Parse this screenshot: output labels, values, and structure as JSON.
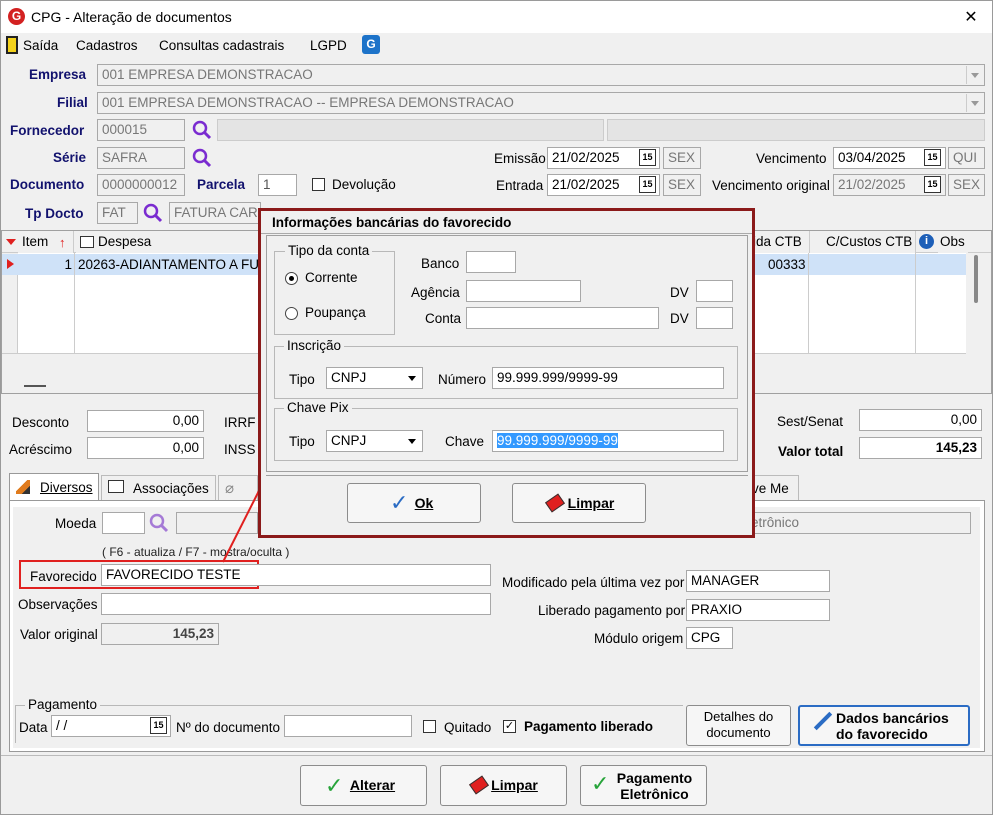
{
  "window": {
    "title": "CPG - Alteração de documentos",
    "close_glyph": "✕"
  },
  "menu": [
    "Saída",
    "Cadastros",
    "Consultas cadastrais",
    "LGPD"
  ],
  "header": {
    "empresa_label": "Empresa",
    "empresa_value": "001 EMPRESA DEMONSTRACAO",
    "filial_label": "Filial",
    "filial_value": "001 EMPRESA DEMONSTRACAO -- EMPRESA DEMONSTRACAO",
    "fornecedor_label": "Fornecedor",
    "fornecedor_value": "000015",
    "serie_label": "Série",
    "serie_value": "SAFRA",
    "documento_label": "Documento",
    "documento_value": "0000000012",
    "parcela_label": "Parcela",
    "parcela_value": "1",
    "devolucao_label": "Devolução",
    "tpdocto_label": "Tp Docto",
    "tpdocto_value": "FAT",
    "tpdocto_desc": "FATURA CAR",
    "emissao_label": "Emissão",
    "emissao_value": "21/02/2025",
    "emissao_day": "SEX",
    "entrada_label": "Entrada",
    "entrada_value": "21/02/2025",
    "entrada_day": "SEX",
    "vencimento_label": "Vencimento",
    "vencimento_value": "03/04/2025",
    "vencimento_day": "QUI",
    "venc_original_label": "Vencimento original",
    "venc_original_value": "21/02/2025",
    "venc_original_day": "SEX",
    "cal_glyph": "15"
  },
  "grid": {
    "col_item": "Item",
    "col_despesa": "Despesa",
    "col_contactb": "ida CTB",
    "col_ccustos": "C/Custos CTB",
    "col_obs": "Obs",
    "row_item": "1",
    "row_despesa": "20263-ADIANTAMENTO A FU",
    "row_contactb": "00333"
  },
  "totals": {
    "desconto_label": "Desconto",
    "desconto_value": "0,00",
    "acrescimo_label": "Acréscimo",
    "acrescimo_value": "0,00",
    "irrf_label": "IRRF",
    "inss_label": "INSS",
    "sest_label": "Sest/Senat",
    "sest_value": "0,00",
    "total_label": "Valor total",
    "total_value": "145,23"
  },
  "tabs": {
    "diversos": "Diversos",
    "associacoes": "Associações",
    "last": "ve Me"
  },
  "diversos": {
    "moeda_label": "Moeda",
    "hint": "( F6 - atualiza / F7 - mostra/oculta )",
    "eletronico_fragment": "etrônico",
    "favorecido_label": "Favorecido",
    "favorecido_value": "FAVORECIDO TESTE",
    "observacoes_label": "Observações",
    "valor_original_label": "Valor original",
    "valor_original_value": "145,23",
    "modificado_label": "Modificado pela última vez por",
    "modificado_value": "MANAGER",
    "liberado_label": "Liberado pagamento por",
    "liberado_value": "PRAXIO",
    "modulo_label": "Módulo origem",
    "modulo_value": "CPG"
  },
  "pagamento": {
    "group": "Pagamento",
    "data_label": "Data",
    "data_value": " /  /",
    "ndoc_label": "Nº do documento",
    "quitado_label": "Quitado",
    "liberado_label": "Pagamento liberado",
    "detalhes_line1": "Detalhes do",
    "detalhes_line2": "documento",
    "dados_line1": "Dados bancários",
    "dados_line2": "do favorecido"
  },
  "footer": {
    "alterar": "Alterar",
    "limpar": "Limpar",
    "pag_line1": "Pagamento",
    "pag_line2": "Eletrônico"
  },
  "dialog": {
    "title": "Informações bancárias do favorecido",
    "tipo_conta": "Tipo da conta",
    "corrente": "Corrente",
    "poupanca": "Poupança",
    "banco": "Banco",
    "agencia": "Agência",
    "conta": "Conta",
    "dv": "DV",
    "inscricao": "Inscrição",
    "tipo": "Tipo",
    "tipo_value": "CNPJ",
    "numero": "Número",
    "numero_value": "99.999.999/9999-99",
    "chave_pix": "Chave Pix",
    "chave": "Chave",
    "chave_tipo_value": "CNPJ",
    "chave_value": "99.999.999/9999-99",
    "ok": "Ok",
    "limpar": "Limpar"
  },
  "colors": {
    "accent_red": "#e0201f",
    "dialog_border": "#8b1a1a",
    "label_blue": "#12126e",
    "selection": "#3399ff",
    "grid_row": "#cfe2f8"
  }
}
